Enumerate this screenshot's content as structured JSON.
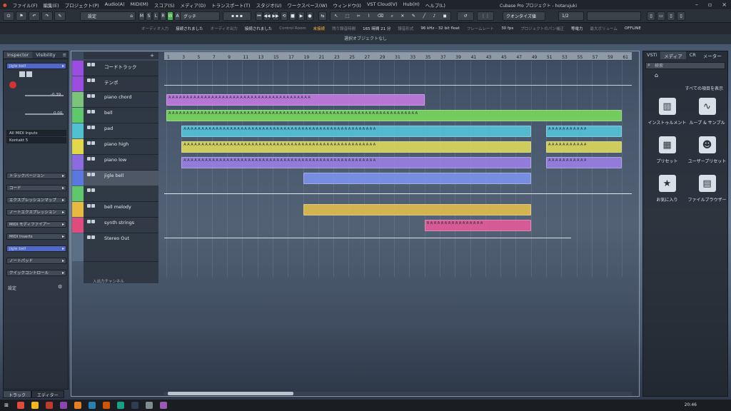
{
  "window": {
    "title": "Cubase Pro プロジェクト - hotarujuki"
  },
  "menu": [
    "ファイル(F)",
    "編集(E)",
    "プロジェクト(P)",
    "Audio(A)",
    "MIDI(M)",
    "スコア(S)",
    "メディア(D)",
    "トランスポート(T)",
    "スタジオ(U)",
    "ワークスペース(W)",
    "ウィンドウ(I)",
    "VST Cloud(V)",
    "Hub(H)",
    "ヘルプ(L)"
  ],
  "toolbar": {
    "preset_label": "設定",
    "mode_buttons": [
      "M",
      "S",
      "L",
      "R",
      "W",
      "A"
    ],
    "snap_label": "グッチ",
    "quantize_label": "クオンタイズ値",
    "quantize_value": "1/2"
  },
  "infobar": [
    {
      "label": "オーディオ入力",
      "value": "接続されました"
    },
    {
      "label": "オーディオ出力",
      "value": "接続されました"
    },
    {
      "label": "Control Room",
      "value": "未接続",
      "highlight": true
    },
    {
      "label": "残り録音時間",
      "value": "165 時間 21 分"
    },
    {
      "label": "録音形式",
      "value": "96 kHz - 32 bit float"
    },
    {
      "label": "フレームレート",
      "value": "30 fps"
    },
    {
      "label": "プロジェクトのパン補正",
      "value": "等電力"
    },
    {
      "label": "最大ボリューム",
      "value": "OFFLINE"
    }
  ],
  "statusline": "選択オブジェクトなし",
  "inspector": {
    "tabs": [
      "Inspector",
      "Visibility"
    ],
    "track_name": "jigle bell",
    "midi_input": "All MIDI Inputs",
    "output": "Kontakt 5",
    "volume_value": "-0.39",
    "pan_value": "0.00",
    "sections": [
      "トラックバージョン",
      "コード",
      "エクスプレッションマップ",
      "ノートエクスプレッション",
      "MIDI モディファイアー",
      "MIDI Inserts",
      "jigle bell",
      "ノートパッド",
      "クイックコントロール"
    ],
    "settings_label": "設定",
    "bottom_tabs": [
      "トラック",
      "エディター"
    ]
  },
  "tracks": [
    {
      "name": "コードトラック",
      "color": "#9a4de0"
    },
    {
      "name": "テンポ",
      "color": "#9a4de0"
    },
    {
      "name": "piano chord",
      "color": "#7bc47a"
    },
    {
      "name": "bell",
      "color": "#5fc86a"
    },
    {
      "name": "pad",
      "color": "#4fc1d1"
    },
    {
      "name": "piano high",
      "color": "#e3d84a"
    },
    {
      "name": "piano low",
      "color": "#8c6be0"
    },
    {
      "name": "jigle bell",
      "color": "#5b78e0"
    },
    {
      "name": "",
      "color": "#5fc86a"
    },
    {
      "name": "bell melody",
      "color": "#e7b93e"
    },
    {
      "name": "synth strings",
      "color": "#e04b7d"
    },
    {
      "name": "Stereo Out",
      "color": "#5b6f86"
    }
  ],
  "inout_channel": "入出力チャンネル",
  "ruler": [
    "1",
    "3",
    "5",
    "7",
    "9",
    "11",
    "13",
    "15",
    "17",
    "19",
    "21",
    "23",
    "25",
    "27",
    "29",
    "31",
    "33",
    "35",
    "37",
    "39",
    "41",
    "43",
    "45",
    "47",
    "49",
    "51",
    "53",
    "55",
    "57",
    "59",
    "61"
  ],
  "clips": [
    {
      "track": 2,
      "start": 1,
      "end": 35,
      "color": "#c77be6",
      "label": "A",
      "kind": "chord"
    },
    {
      "track": 3,
      "start": 1,
      "end": 61,
      "color": "#7bdc5c",
      "label": "A"
    },
    {
      "track": 4,
      "start": 3,
      "end": 49,
      "color": "#55c7dc",
      "label": "A"
    },
    {
      "track": 4,
      "start": 51,
      "end": 61,
      "color": "#55c7dc",
      "label": "A"
    },
    {
      "track": 5,
      "start": 3,
      "end": 49,
      "color": "#e0dc5a",
      "label": "A"
    },
    {
      "track": 5,
      "start": 51,
      "end": 61,
      "color": "#e0dc5a",
      "label": "A"
    },
    {
      "track": 6,
      "start": 3,
      "end": 49,
      "color": "#9b82e8",
      "label": "A"
    },
    {
      "track": 6,
      "start": 51,
      "end": 61,
      "color": "#9b82e8",
      "label": "A"
    },
    {
      "track": 7,
      "start": 19,
      "end": 49,
      "color": "#7d95f0",
      "label": ""
    },
    {
      "track": 9,
      "start": 19,
      "end": 49,
      "color": "#e7c04a",
      "label": ""
    },
    {
      "track": 10,
      "start": 35,
      "end": 49,
      "color": "#e85a9a",
      "label": "A"
    }
  ],
  "media": {
    "tabs": [
      "VSTi",
      "メディア",
      "CR",
      "メーター"
    ],
    "search_placeholder": "検索",
    "show_all": "すべての項目を表示",
    "tiles": [
      {
        "label": "インストゥルメント",
        "icon": "piano-keys-icon"
      },
      {
        "label": "ループ & サンプル",
        "icon": "waveform-icon"
      },
      {
        "label": "プリセット",
        "icon": "preset-grid-icon"
      },
      {
        "label": "ユーザープリセット",
        "icon": "user-icon"
      },
      {
        "label": "お気に入り",
        "icon": "star-icon"
      },
      {
        "label": "ファイルブラウザー",
        "icon": "drive-icon"
      }
    ]
  },
  "taskbar": {
    "clock": "20:46"
  }
}
